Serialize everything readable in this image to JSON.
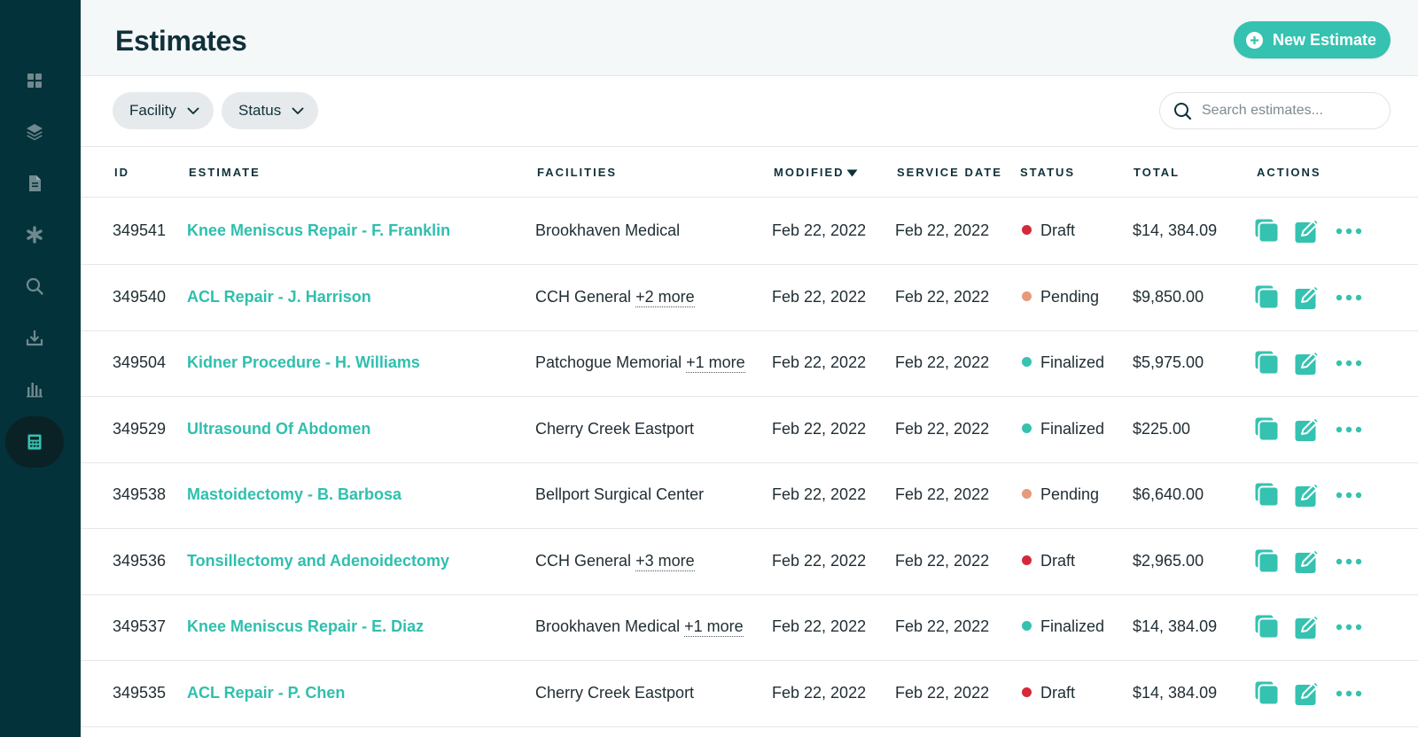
{
  "sidebar": {
    "items": [
      {
        "icon": "dashboard-grid-icon",
        "active": false
      },
      {
        "icon": "layers-icon",
        "active": false
      },
      {
        "icon": "document-icon",
        "active": false
      },
      {
        "icon": "asterisk-icon",
        "active": false
      },
      {
        "icon": "search-icon",
        "active": false
      },
      {
        "icon": "download-icon",
        "active": false
      },
      {
        "icon": "bar-chart-icon",
        "active": false
      },
      {
        "icon": "calculator-icon",
        "active": true
      }
    ]
  },
  "header": {
    "title": "Estimates",
    "new_button_label": "New Estimate"
  },
  "filters": {
    "facility_label": "Facility",
    "status_label": "Status",
    "search_placeholder": "Search estimates..."
  },
  "table": {
    "columns": {
      "id": "ID",
      "estimate": "ESTIMATE",
      "facilities": "FACILITIES",
      "modified": "MODIFIED",
      "service_date": "SERVICE DATE",
      "status": "STATUS",
      "total": "TOTAL",
      "actions": "ACTIONS"
    },
    "rows": [
      {
        "id": "349541",
        "estimate": "Knee Meniscus Repair - F. Franklin",
        "facility": "Brookhaven Medical",
        "more": "",
        "modified": "Feb 22, 2022",
        "service_date": "Feb 22, 2022",
        "status": "Draft",
        "total": "$14, 384.09"
      },
      {
        "id": "349540",
        "estimate": "ACL Repair - J. Harrison",
        "facility": "CCH General",
        "more": "+2 more",
        "modified": "Feb 22, 2022",
        "service_date": "Feb 22, 2022",
        "status": "Pending",
        "total": "$9,850.00"
      },
      {
        "id": "349504",
        "estimate": "Kidner Procedure - H. Williams",
        "facility": "Patchogue Memorial",
        "more": "+1 more",
        "modified": "Feb 22, 2022",
        "service_date": "Feb 22, 2022",
        "status": "Finalized",
        "total": "$5,975.00"
      },
      {
        "id": "349529",
        "estimate": "Ultrasound Of Abdomen",
        "facility": "Cherry Creek Eastport",
        "more": "",
        "modified": "Feb 22, 2022",
        "service_date": "Feb 22, 2022",
        "status": "Finalized",
        "total": "$225.00"
      },
      {
        "id": "349538",
        "estimate": "Mastoidectomy - B. Barbosa",
        "facility": "Bellport Surgical Center",
        "more": "",
        "modified": "Feb 22, 2022",
        "service_date": "Feb 22, 2022",
        "status": "Pending",
        "total": "$6,640.00"
      },
      {
        "id": "349536",
        "estimate": "Tonsillectomy and Adenoidectomy",
        "facility": "CCH General",
        "more": "+3 more",
        "modified": "Feb 22, 2022",
        "service_date": "Feb 22, 2022",
        "status": "Draft",
        "total": "$2,965.00"
      },
      {
        "id": "349537",
        "estimate": "Knee Meniscus Repair - E. Diaz",
        "facility": "Brookhaven Medical",
        "more": "+1 more",
        "modified": "Feb 22, 2022",
        "service_date": "Feb 22, 2022",
        "status": "Finalized",
        "total": "$14, 384.09"
      },
      {
        "id": "349535",
        "estimate": "ACL Repair - P. Chen",
        "facility": "Cherry Creek Eastport",
        "more": "",
        "modified": "Feb 22, 2022",
        "service_date": "Feb 22, 2022",
        "status": "Draft",
        "total": "$14, 384.09"
      }
    ]
  },
  "colors": {
    "sidebar_bg": "#04323a",
    "accent": "#35c2b0",
    "status_draft": "#d7283a",
    "status_pending": "#e69a7a",
    "status_finalized": "#35c2b0"
  },
  "row_actions": [
    "duplicate-icon",
    "edit-icon",
    "more-options-icon"
  ]
}
